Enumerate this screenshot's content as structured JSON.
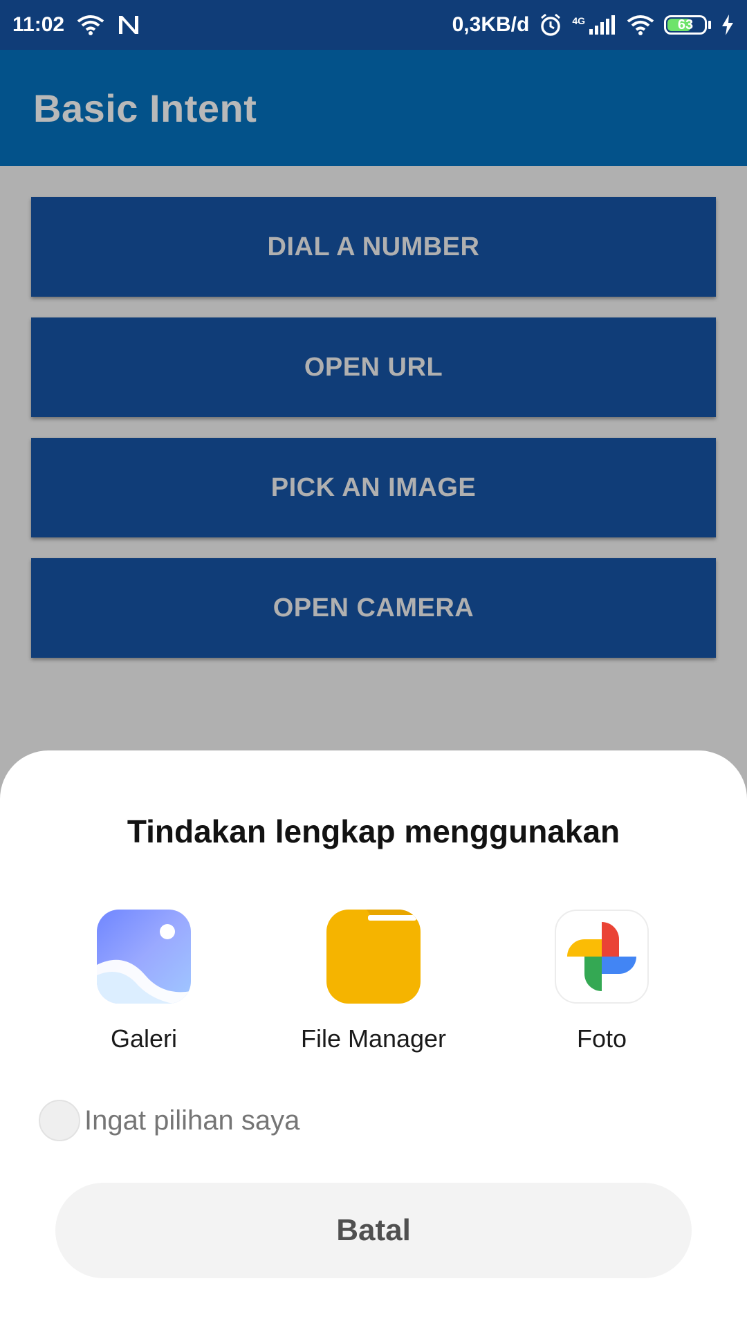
{
  "status_bar": {
    "time": "11:02",
    "data_rate": "0,3KB/d",
    "network_type": "4G",
    "battery_level": "63",
    "icons": [
      "wifi-icon",
      "notification-n-icon",
      "alarm-icon",
      "signal-icon",
      "wifi-icon",
      "battery-icon",
      "charging-icon"
    ]
  },
  "app_bar": {
    "title": "Basic Intent"
  },
  "buttons": [
    {
      "label": "DIAL A NUMBER"
    },
    {
      "label": "OPEN URL"
    },
    {
      "label": "PICK AN IMAGE"
    },
    {
      "label": "OPEN CAMERA"
    }
  ],
  "chooser": {
    "title": "Tindakan lengkap menggunakan",
    "apps": [
      {
        "label": "Galeri",
        "icon": "gallery-icon"
      },
      {
        "label": "File Manager",
        "icon": "folder-icon"
      },
      {
        "label": "Foto",
        "icon": "google-photos-icon"
      }
    ],
    "remember_label": "Ingat pilihan saya",
    "remember_checked": false,
    "cancel_label": "Batal"
  },
  "colors": {
    "status_bar": "#103d78",
    "app_bar": "#03528a",
    "button": "#103d78",
    "scrim": "#b0b0b0",
    "sheet": "#ffffff"
  }
}
